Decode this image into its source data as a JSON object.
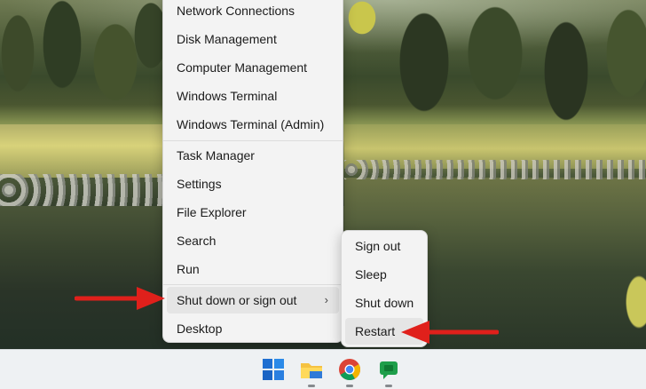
{
  "menu": {
    "items": [
      {
        "label": "Network Connections"
      },
      {
        "label": "Disk Management"
      },
      {
        "label": "Computer Management"
      },
      {
        "label": "Windows Terminal"
      },
      {
        "label": "Windows Terminal (Admin)"
      },
      {
        "label": "Task Manager"
      },
      {
        "label": "Settings"
      },
      {
        "label": "File Explorer"
      },
      {
        "label": "Search"
      },
      {
        "label": "Run"
      },
      {
        "label": "Shut down or sign out"
      },
      {
        "label": "Desktop"
      }
    ],
    "submenu_chevron": "›"
  },
  "submenu": {
    "items": [
      {
        "label": "Sign out"
      },
      {
        "label": "Sleep"
      },
      {
        "label": "Shut down"
      },
      {
        "label": "Restart"
      }
    ]
  },
  "taskbar": {
    "icons": [
      "windows-start-icon",
      "file-explorer-icon",
      "chrome-icon",
      "chat-icon"
    ]
  },
  "colors": {
    "annotation_arrow": "#e0201b",
    "menu_bg": "#f3f3f3",
    "hover_bg": "#e5e5e5"
  }
}
